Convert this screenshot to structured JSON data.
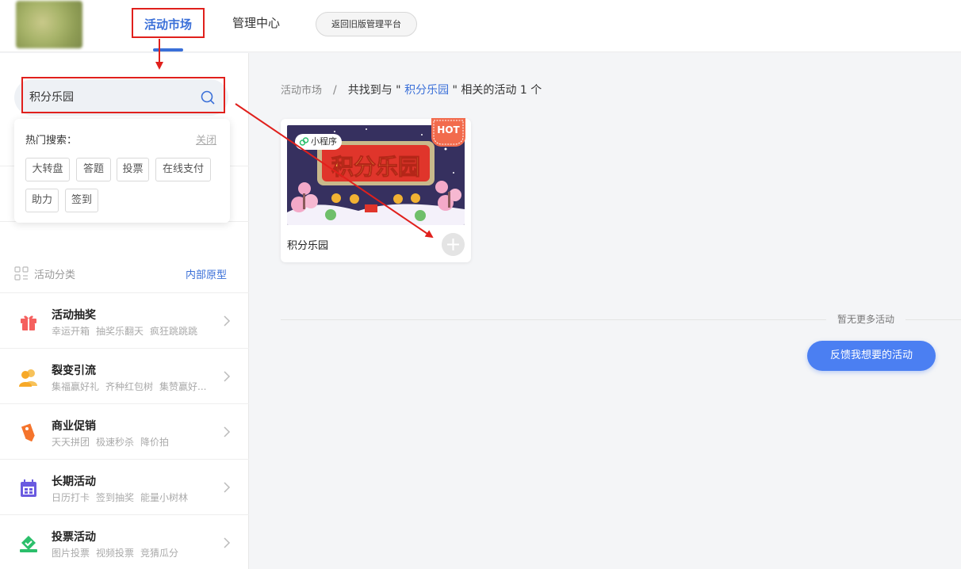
{
  "header": {
    "nav_market": "活动市场",
    "nav_manage": "管理中心",
    "old_platform": "返回旧版管理平台"
  },
  "search": {
    "value": "积分乐园"
  },
  "hot_search": {
    "title": "热门搜索：",
    "close": "关闭",
    "tags": [
      "大转盘",
      "答题",
      "投票",
      "在线支付",
      "助力",
      "签到"
    ]
  },
  "categories": {
    "title": "活动分类",
    "internal_link": "内部原型",
    "items": [
      {
        "name": "活动抽奖",
        "subs": [
          "幸运开箱",
          "抽奖乐翻天",
          "疯狂跳跳跳"
        ],
        "icon": "gift-icon",
        "color": "#f5605e"
      },
      {
        "name": "裂变引流",
        "subs": [
          "集福赢好礼",
          "齐种红包树",
          "集赞赢好..."
        ],
        "icon": "users-icon",
        "color": "#f7a928"
      },
      {
        "name": "商业促销",
        "subs": [
          "天天拼团",
          "极速秒杀",
          "降价拍"
        ],
        "icon": "tag-icon",
        "color": "#f5742c"
      },
      {
        "name": "长期活动",
        "subs": [
          "日历打卡",
          "签到抽奖",
          "能量小树林"
        ],
        "icon": "calendar-icon",
        "color": "#6a5ae0"
      },
      {
        "name": "投票活动",
        "subs": [
          "图片投票",
          "视频投票",
          "竞猜瓜分"
        ],
        "icon": "vote-icon",
        "color": "#2bbf6b"
      }
    ]
  },
  "breadcrumb": {
    "root": "活动市场",
    "sep": "/",
    "prefix": "共找到与 \" ",
    "keyword": "积分乐园",
    "suffix": " \" 相关的活动 1 个"
  },
  "card": {
    "title": "积分乐园",
    "badge": "小程序",
    "hot": "HOT",
    "banner_text": "积分乐园"
  },
  "footer": {
    "no_more": "暂无更多活动",
    "feedback": "反馈我想要的活动"
  },
  "colors": {
    "accent": "#3a6fd8",
    "annotation": "#e0201c",
    "button": "#4b7ff2"
  }
}
